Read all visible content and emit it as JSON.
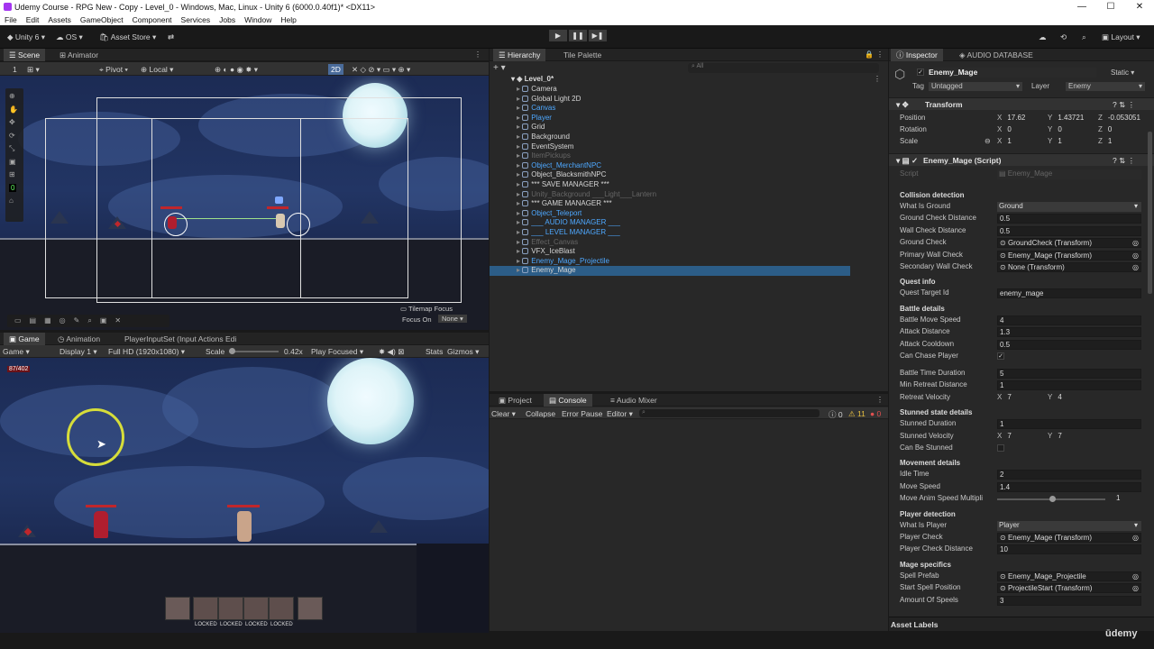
{
  "window": {
    "title": "Udemy Course - RPG New - Copy - Level_0 - Windows, Mac, Linux - Unity 6 (6000.0.40f1)* <DX11>"
  },
  "menu": [
    "File",
    "Edit",
    "Assets",
    "GameObject",
    "Component",
    "Services",
    "Jobs",
    "Window",
    "Help"
  ],
  "toolbar": {
    "account": "Unity 6",
    "os": "OS",
    "asset_store": "Asset Store",
    "layout": "Layout"
  },
  "scene": {
    "tabs": [
      "Scene",
      "Animator"
    ],
    "pivot": "Pivot",
    "local": "Local",
    "mode2d": "2D",
    "tilemap_focus": "Tilemap Focus",
    "focus_on": "Focus On",
    "none": "None"
  },
  "game": {
    "tabs": [
      "Game",
      "Animation",
      "PlayerInputSet (Input Actions Edi"
    ],
    "display": "Game",
    "display_num": "Display 1",
    "resolution": "Full HD (1920x1080)",
    "scale_label": "Scale",
    "scale_value": "0.42x",
    "play_focused": "Play Focused",
    "stats": "Stats",
    "gizmos": "Gizmos",
    "hp": "87/402",
    "locked": [
      "LOCKED",
      "LOCKED",
      "LOCKED",
      "LOCKED"
    ]
  },
  "hierarchy": {
    "tabs": [
      "Hierarchy",
      "Tile Palette"
    ],
    "scene": "Level_0*",
    "items": [
      {
        "name": "Camera",
        "blue": false
      },
      {
        "name": "Global Light 2D",
        "blue": false
      },
      {
        "name": "Canvas",
        "blue": true
      },
      {
        "name": "Player",
        "blue": true
      },
      {
        "name": "Grid",
        "blue": false
      },
      {
        "name": "Background",
        "blue": false
      },
      {
        "name": "EventSystem",
        "blue": false
      },
      {
        "name": "ItemPickups",
        "blue": false,
        "dim": true
      },
      {
        "name": "Object_MerchantNPC",
        "blue": true
      },
      {
        "name": "Object_BlacksmithNPC",
        "blue": false
      },
      {
        "name": "*** SAVE MANAGER ***",
        "blue": false
      },
      {
        "name": "Unity_Background ___Light___Lantern",
        "blue": false,
        "dim": true
      },
      {
        "name": "*** GAME MANAGER ***",
        "blue": false
      },
      {
        "name": "Object_Teleport",
        "blue": true
      },
      {
        "name": "___ AUDIO MANAGER ___",
        "blue": true
      },
      {
        "name": "___ LEVEL MANAGER ___",
        "blue": true
      },
      {
        "name": "Effect_Canvas",
        "blue": false,
        "dim": true
      },
      {
        "name": "VFX_IceBlast",
        "blue": false
      },
      {
        "name": "Enemy_Mage_Projectile",
        "blue": true
      },
      {
        "name": "Enemy_Mage",
        "blue": false
      }
    ]
  },
  "console": {
    "tabs": [
      "Project",
      "Console",
      "Audio Mixer"
    ],
    "clear": "Clear",
    "collapse": "Collapse",
    "error_pause": "Error Pause",
    "editor": "Editor",
    "count_info": "0",
    "count_warn": "11",
    "count_error": "0"
  },
  "inspector": {
    "tabs": [
      "Inspector",
      "AUDIO DATABASE"
    ],
    "object_name": "Enemy_Mage",
    "static": "Static",
    "tag_label": "Tag",
    "tag": "Untagged",
    "layer_label": "Layer",
    "layer": "Enemy",
    "transform": {
      "title": "Transform",
      "position": {
        "label": "Position",
        "x": "17.62",
        "y": "1.43721",
        "z": "-0.053051"
      },
      "rotation": {
        "label": "Rotation",
        "x": "0",
        "y": "0",
        "z": "0"
      },
      "scale": {
        "label": "Scale",
        "x": "1",
        "y": "1",
        "z": "1"
      }
    },
    "script_title": "Enemy_Mage (Script)",
    "script_label": "Script",
    "script_value": "Enemy_Mage",
    "collision": {
      "header": "Collision detection",
      "what_is_ground": [
        "What Is Ground",
        "Ground"
      ],
      "ground_check_distance": [
        "Ground Check Distance",
        "0.5"
      ],
      "wall_check_distance": [
        "Wall Check Distance",
        "0.5"
      ],
      "ground_check": [
        "Ground Check",
        "GroundCheck (Transform)"
      ],
      "primary_wall_check": [
        "Primary Wall Check",
        "Enemy_Mage (Transform)"
      ],
      "secondary_wall_check": [
        "Secondary Wall Check",
        "None (Transform)"
      ]
    },
    "quest": {
      "header": "Quest info",
      "target": [
        "Quest Target Id",
        "enemy_mage"
      ]
    },
    "battle": {
      "header": "Battle details",
      "move_speed": [
        "Battle Move Speed",
        "4"
      ],
      "attack_distance": [
        "Attack Distance",
        "1.3"
      ],
      "attack_cooldown": [
        "Attack Cooldown",
        "0.5"
      ],
      "can_chase": [
        "Can Chase Player",
        "✓"
      ],
      "time_duration": [
        "Battle Time Duration",
        "5"
      ],
      "min_retreat": [
        "Min Retreat Distance",
        "1"
      ],
      "retreat_velocity": [
        "Retreat Velocity",
        "7",
        "4"
      ]
    },
    "stunned": {
      "header": "Stunned state details",
      "duration": [
        "Stunned Duration",
        "1"
      ],
      "velocity": [
        "Stunned Velocity",
        "7",
        "7"
      ],
      "can_be_stunned": [
        "Can Be Stunned",
        ""
      ]
    },
    "movement": {
      "header": "Movement details",
      "idle_time": [
        "Idle Time",
        "2"
      ],
      "move_speed": [
        "Move Speed",
        "1.4"
      ],
      "anim_mult": [
        "Move Anim Speed Multipli",
        "1"
      ]
    },
    "player_detect": {
      "header": "Player detection",
      "what_is_player": [
        "What Is Player",
        "Player"
      ],
      "player_check": [
        "Player Check",
        "Enemy_Mage (Transform)"
      ],
      "distance": [
        "Player Check Distance",
        "10"
      ]
    },
    "mage": {
      "header": "Mage specifics",
      "spell_prefab": [
        "Spell Prefab",
        "Enemy_Mage_Projectile"
      ],
      "start_spell": [
        "Start Spell Position",
        "ProjectileStart (Transform)"
      ],
      "amount": [
        "Amount Of Speels",
        "3"
      ]
    },
    "asset_labels": "Asset Labels"
  },
  "colors": {
    "accent": "#4ea8ff",
    "hp_red": "#c0262b",
    "night_sky": "#1c2b54"
  }
}
